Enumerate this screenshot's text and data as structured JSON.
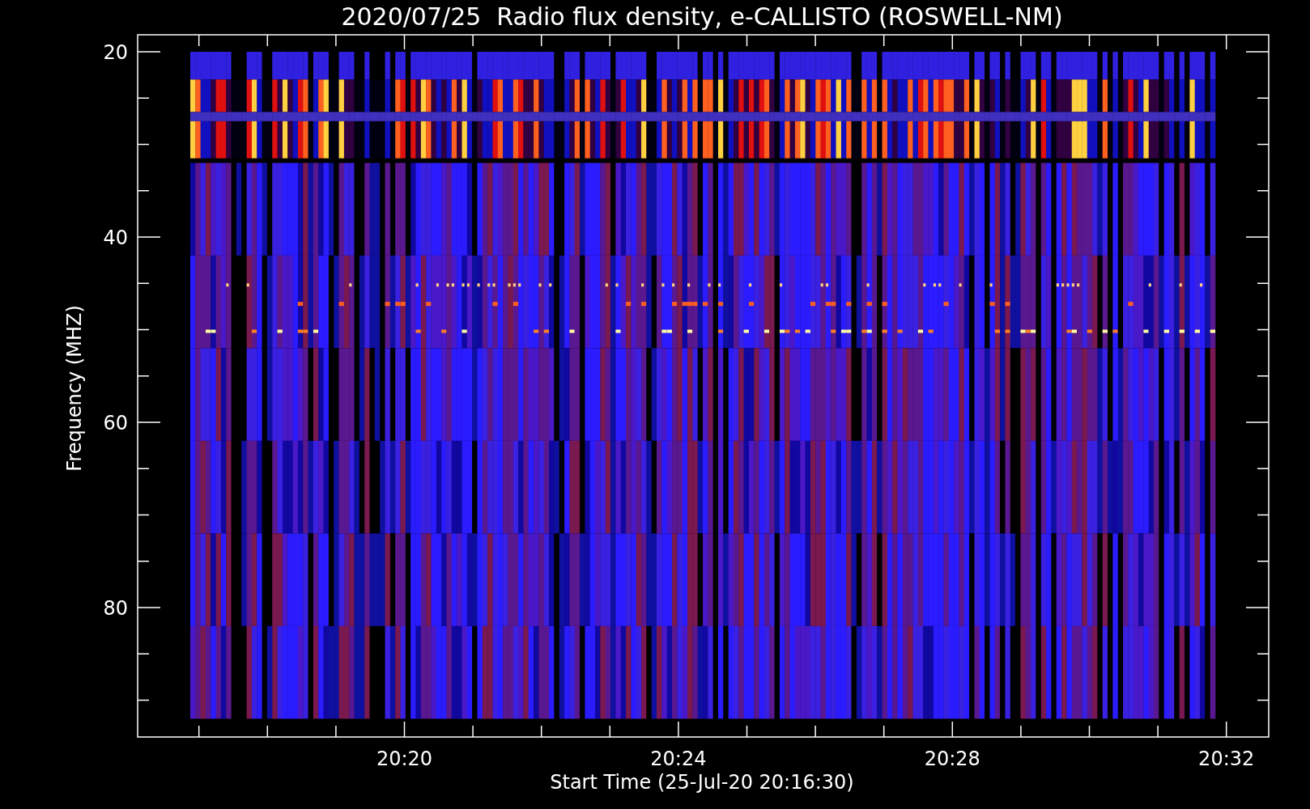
{
  "title": "2020/07/25  Radio flux density, e-CALLISTO (ROSWELL-NM)",
  "y_axis": {
    "label": "Frequency (MHZ)",
    "ticks": [
      "20",
      "40",
      "60",
      "80"
    ]
  },
  "x_axis": {
    "label": "Start Time (25-Jul-20 20:16:30)",
    "ticks": [
      "20:20",
      "20:24",
      "20:28",
      "20:32"
    ]
  }
}
